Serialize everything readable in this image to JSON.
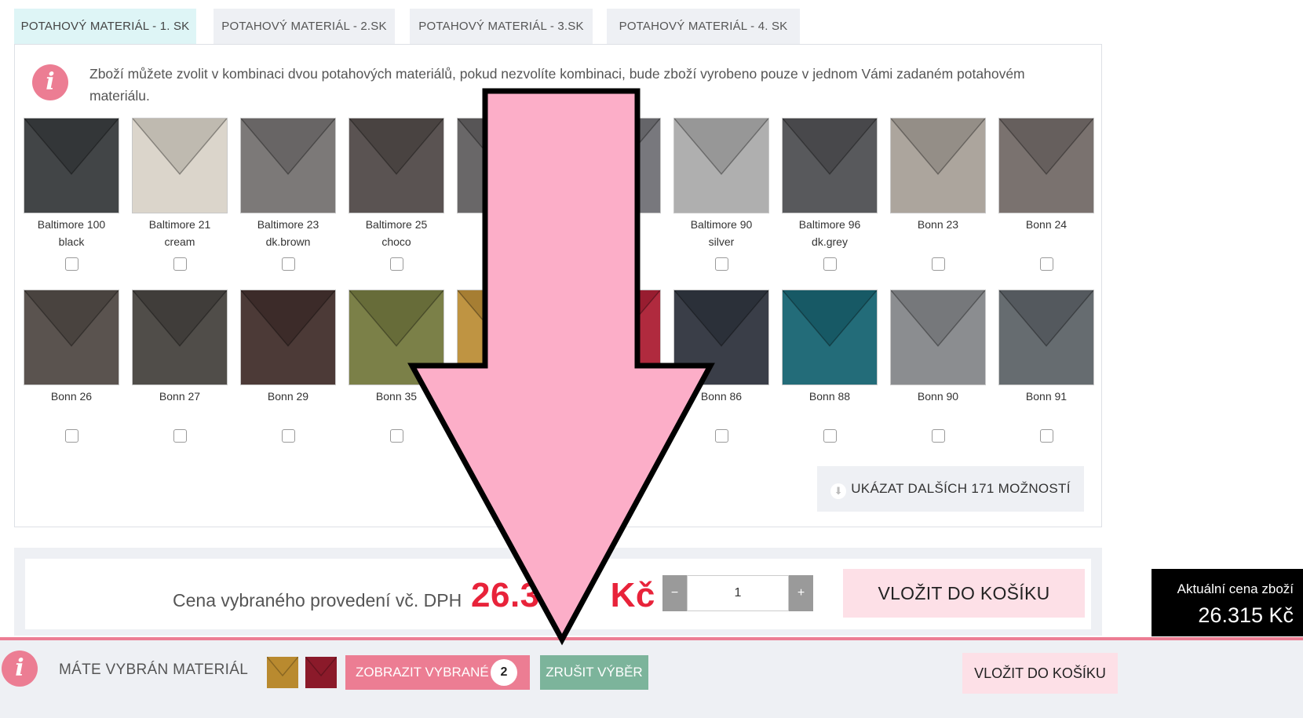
{
  "tabs": [
    {
      "label": "POTAHOVÝ MATERIÁL - 1. SK",
      "active": true
    },
    {
      "label": "POTAHOVÝ MATERIÁL - 2.SK",
      "active": false
    },
    {
      "label": "POTAHOVÝ MATERIÁL - 3.SK",
      "active": false
    },
    {
      "label": "POTAHOVÝ MATERIÁL - 4. SK",
      "active": false
    }
  ],
  "info_icon": "info-icon",
  "info_text": "Zboží můžete zvolit v kombinaci dvou potahových materiálů, pokud nezvolíte kombinaci, bude zboží vyrobeno pouze v jednom Vámi zadaném potahovém materiálu.",
  "swatches_row1": [
    {
      "line1": "Baltimore 100",
      "line2": "black",
      "color": "#2f3235"
    },
    {
      "line1": "Baltimore 21",
      "line2": "cream",
      "color": "#d8d2c6"
    },
    {
      "line1": "Baltimore 23",
      "line2": "dk.brown",
      "color": "#6f6c6b"
    },
    {
      "line1": "Baltimore 25",
      "line2": "choco",
      "color": "#4a4240"
    },
    {
      "line1": "Ba",
      "line2": "c",
      "color": "#5a5859"
    },
    {
      "line1": "9",
      "line2": "",
      "color": "#6b6b70"
    },
    {
      "line1": "Baltimore 90",
      "line2": "silver",
      "color": "#a7a7a7"
    },
    {
      "line1": "Baltimore 96",
      "line2": "dk.grey",
      "color": "#48494c"
    },
    {
      "line1": "Bonn 23",
      "line2": "",
      "color": "#a49d94"
    },
    {
      "line1": "Bonn 24",
      "line2": "",
      "color": "#6d6461"
    }
  ],
  "swatches_row2": [
    {
      "line1": "Bonn 26",
      "line2": "",
      "color": "#4a423d"
    },
    {
      "line1": "Bonn 27",
      "line2": "",
      "color": "#3e3b37"
    },
    {
      "line1": "Bonn 29",
      "line2": "",
      "color": "#3a2622"
    },
    {
      "line1": "Bonn 35",
      "line2": "",
      "color": "#6e7336"
    },
    {
      "line1": "",
      "line2": "",
      "color": "#b98a2f"
    },
    {
      "line1": "",
      "line2": "",
      "color": "#a8152b"
    },
    {
      "line1": "Bonn 86",
      "line2": "",
      "color": "#262b36"
    },
    {
      "line1": "Bonn 88",
      "line2": "",
      "color": "#0d5d6c"
    },
    {
      "line1": "Bonn 90",
      "line2": "",
      "color": "#808285"
    },
    {
      "line1": "Bonn 91",
      "line2": "",
      "color": "#575d62"
    }
  ],
  "more_button": {
    "label": "UKÁZAT DALŠÍCH 171 MOŽNOSTÍ",
    "icon": "download-circle-icon"
  },
  "price": {
    "label": "Cena vybraného provedení vč. DPH",
    "value": "26.3",
    "currency": "Kč"
  },
  "quantity": {
    "value": "1",
    "minus": "−",
    "plus": "+"
  },
  "cart_button": "VLOŽIT DO KOŠÍKU",
  "floating_price": {
    "title": "Aktuální cena zboží",
    "value": "26.315 Kč"
  },
  "bottom_bar": {
    "label": "MÁTE VYBRÁN MATERIÁL",
    "selected_colors": [
      "#b98a2f",
      "#8b1a2a"
    ],
    "show_selected": "ZOBRAZIT VYBRANÉ",
    "count": "2",
    "cancel": "ZRUŠIT VÝBĚR",
    "cart": "VLOŽIT DO KOŠÍKU"
  },
  "colors": {
    "accent_pink": "#ec7d93",
    "price_red": "#e8233a",
    "cancel_green": "#7cb49b",
    "arrow_fill": "#fcaec8"
  }
}
